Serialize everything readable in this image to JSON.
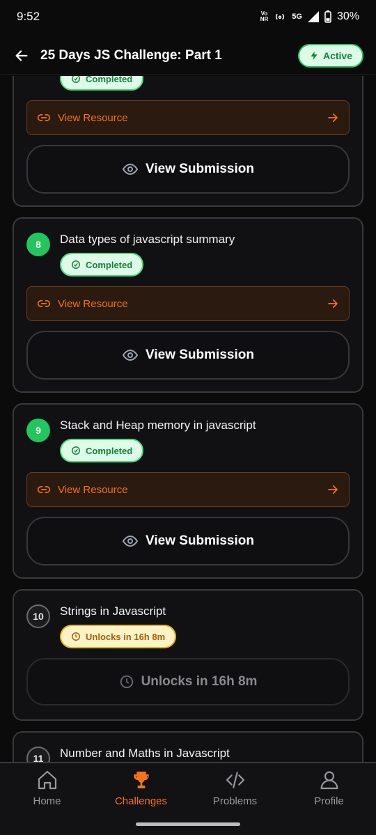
{
  "status_bar": {
    "time": "9:52",
    "volte_top": "Vo",
    "volte_bottom": "NR",
    "network": "5G",
    "battery": "30%"
  },
  "header": {
    "title": "25 Days JS Challenge: Part 1",
    "badge": "Active"
  },
  "cards": [
    {
      "number": "",
      "title": "",
      "status": "Completed",
      "resource_label": "View Resource",
      "submission_label": "View Submission"
    },
    {
      "number": "8",
      "title": "Data types of javascript summary",
      "status": "Completed",
      "resource_label": "View Resource",
      "submission_label": "View Submission"
    },
    {
      "number": "9",
      "title": "Stack and Heap memory in javascript",
      "status": "Completed",
      "resource_label": "View Resource",
      "submission_label": "View Submission"
    },
    {
      "number": "10",
      "title": "Strings in Javascript",
      "status": "Unlocks in 16h 8m",
      "submission_label": "Unlocks in 16h 8m"
    },
    {
      "number": "11",
      "title": "Number and Maths in Javascript"
    }
  ],
  "nav": [
    {
      "label": "Home",
      "icon": "home-icon"
    },
    {
      "label": "Challenges",
      "icon": "trophy-icon"
    },
    {
      "label": "Problems",
      "icon": "code-icon"
    },
    {
      "label": "Profile",
      "icon": "user-icon"
    }
  ],
  "colors": {
    "accent": "#f97316",
    "success": "#22c55e",
    "warning": "#eab308"
  }
}
